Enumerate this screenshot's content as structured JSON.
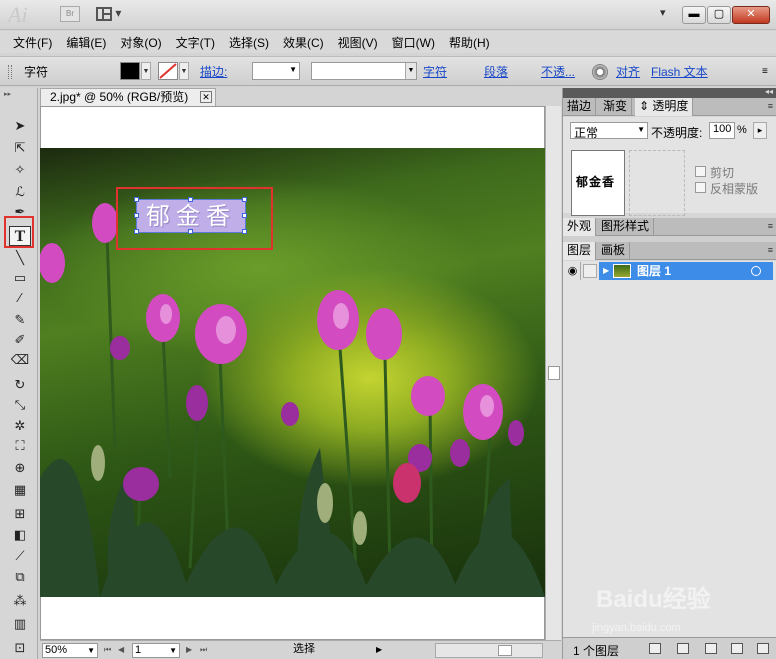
{
  "titlebar": {
    "app_logo": "Ai",
    "bridge_label": "Br"
  },
  "menubar": [
    "文件(F)",
    "编辑(E)",
    "对象(O)",
    "文字(T)",
    "选择(S)",
    "效果(C)",
    "视图(V)",
    "窗口(W)",
    "帮助(H)"
  ],
  "controlbar": {
    "type_label": "字符",
    "stroke_label": "描边:",
    "char_link": "字符",
    "para_link": "段落",
    "opacity_link": "不透...",
    "align_link": "对齐",
    "flash_link": "Flash 文本"
  },
  "document": {
    "tab_title": "2.jpg* @ 50% (RGB/预览)",
    "artwork_text": "郁金香"
  },
  "statusbar": {
    "zoom": "50%",
    "page": "1",
    "status": "选择"
  },
  "panels": {
    "top_tabs": [
      "描边",
      "渐变",
      "透明度"
    ],
    "blend_mode": "正常",
    "opacity_label": "不透明度:",
    "opacity_value": "100",
    "opacity_unit": "%",
    "thumb_text": "郁金香",
    "clip_label": "剪切",
    "invert_label": "反相蒙版",
    "mid_tabs": [
      "外观",
      "图形样式"
    ],
    "layer_tabs": [
      "图层",
      "画板"
    ],
    "layer_name": "图层 1",
    "layer_count": "1 个图层"
  },
  "watermark": {
    "brand": "Baidu经验",
    "url": "jingyan.baidu.com"
  },
  "colors": {
    "selection_blue": "#3d8ce8",
    "highlight_red": "#e0332d",
    "close_red": "#c2391f"
  }
}
